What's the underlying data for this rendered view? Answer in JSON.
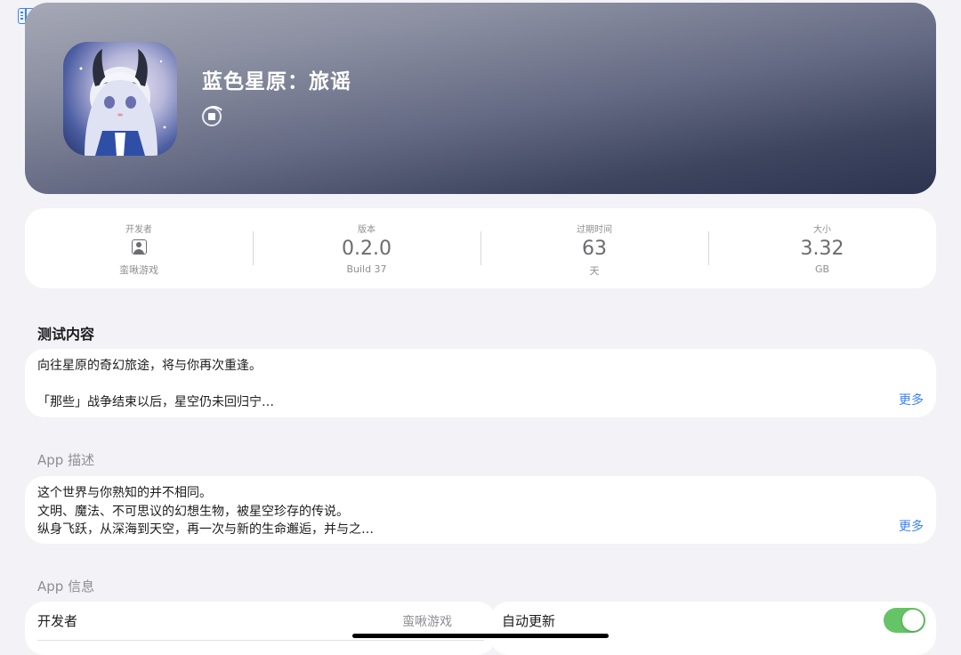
{
  "app": {
    "title": "蓝色星原：旅谣"
  },
  "stats": [
    {
      "label": "开发者",
      "value": "",
      "sub": "蛮啾游戏"
    },
    {
      "label": "版本",
      "value": "0.2.0",
      "sub": "Build 37"
    },
    {
      "label": "过期时间",
      "value": "63",
      "sub": "天"
    },
    {
      "label": "大小",
      "value": "3.32",
      "sub": "GB"
    }
  ],
  "test_content": {
    "title": "测试内容",
    "lines": [
      "向往星原的奇幻旅途，将与你再次重逢。",
      "",
      "「那些」战争结束以后，星空仍未回归宁…"
    ],
    "more": "更多"
  },
  "description": {
    "title": "App 描述",
    "lines": [
      "这个世界与你熟知的并不相同。",
      "文明、魔法、不可思议的幻想生物，被星空珍存的传说。",
      "纵身飞跃，从深海到天空，再一次与新的生命邂逅，并与之…"
    ],
    "more": "更多"
  },
  "info": {
    "title": "App 信息",
    "developer_label": "开发者",
    "developer_value": "蛮啾游戏",
    "auto_update_label": "自动更新",
    "auto_update_on": true
  },
  "colors": {
    "accent": "#3a82f7",
    "toggle_on": "#65c466",
    "background": "#f2f2f7"
  }
}
